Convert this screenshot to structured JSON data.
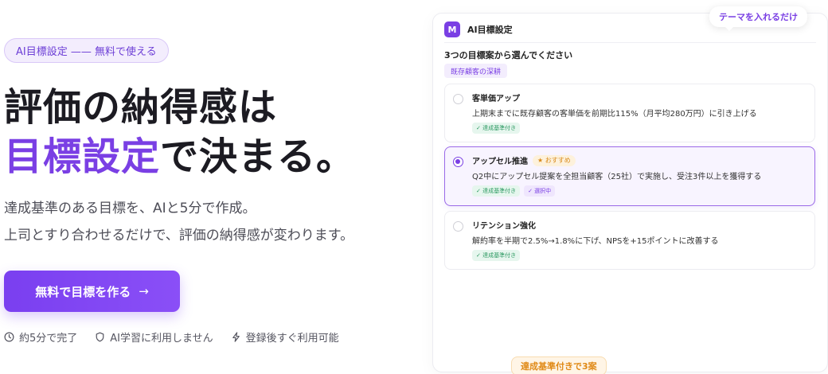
{
  "hero": {
    "pill_text": "AI目標設定 —— 無料で使える",
    "headline_line1": "評価の納得感は",
    "headline_accent": "目標設定",
    "headline_line2_rest": "で決まる。",
    "sub_line1": "達成基準のある目標を、AIと5分で作成。",
    "sub_line2": "上司とすり合わせるだけで、評価の納得感が変わります。",
    "cta_label": "無料で目標を作る",
    "cta_arrow": "→",
    "features": [
      {
        "icon": "clock-icon",
        "label": "約5分で完了"
      },
      {
        "icon": "shield-icon",
        "label": "AI学習に利用しません"
      },
      {
        "icon": "lightning-icon",
        "label": "登録後すぐ利用可能"
      }
    ]
  },
  "card": {
    "logo_letter": "M",
    "title": "AI目標設定",
    "tooltip": "テーマを入れるだけ",
    "prompt": "3つの目標案から選んでください",
    "category_tag": "既存顧客の深耕",
    "options": [
      {
        "title": "客単価アップ",
        "desc": "上期末までに既存顧客の客単価を前期比115%（月平均280万円）に引き上げる",
        "chip": "✓ 達成基準付き",
        "selected": false
      },
      {
        "title": "アップセル推進",
        "badge": "★ おすすめ",
        "desc": "Q2中にアップセル提案を全担当顧客（25社）で実施し、受注3件以上を獲得する",
        "chip": "✓ 達成基準付き",
        "chip_selected": "✓ 選択中",
        "selected": true
      },
      {
        "title": "リテンション強化",
        "desc": "解約率を半期で2.5%→1.8%に下げ、NPSを+15ポイントに改善する",
        "chip": "✓ 達成基準付き",
        "selected": false
      }
    ],
    "bottom_badge": "達成基準付きで3案"
  },
  "colors": {
    "accent": "#7a3fe4",
    "green": "#2e9a63",
    "orange": "#e08a17"
  }
}
